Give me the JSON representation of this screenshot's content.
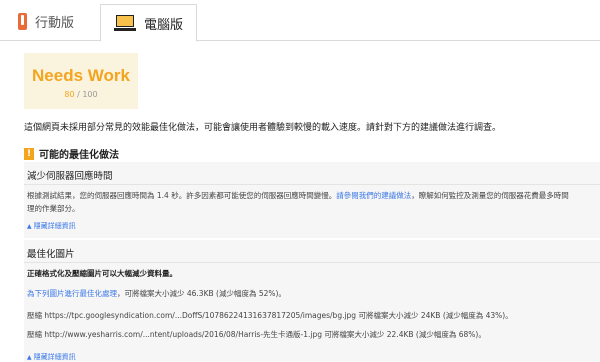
{
  "tabs": {
    "mobile": "行動版",
    "desktop": "電腦版"
  },
  "score": {
    "label": "Needs Work",
    "value": "80",
    "suffix": " / 100"
  },
  "intro": "這個網頁未採用部分常見的效能最佳化做法，可能會讓使用者體驗到較慢的載入速度。請針對下方的建議做法進行調查。",
  "possible": {
    "icon": "!",
    "title": "可能的最佳化做法"
  },
  "rule1": {
    "title": "減少伺服器回應時間",
    "text_prefix": "根據測試結果，您的伺服器回應時間為 1.4 秒。許多因素都可能使您的伺服器回應時間變慢。",
    "link": "請參閱我們的建議做法",
    "text_suffix": "，瞭解如何監控及測量您的伺服器花費最多時間",
    "text_line2": "理的作業部分。",
    "toggle": "隱藏詳細資訊"
  },
  "rule2": {
    "title": "最佳化圖片",
    "subtitle": "正確格式化及壓縮圖片可以大幅減少資料量。",
    "link_line_link": "為下列圖片進行最佳化處理",
    "link_line_text": "，可將檔案大小減少 46.3KB (減少幅度為 52%)。",
    "item1": "壓縮 https://tpc.googlesyndication.com/...DoffS/10786224131637817205/images/bg.jpg 可將檔案大小減少 24KB (減少幅度為 43%)。",
    "item2": "壓縮 http://www.yesharris.com/...ntent/uploads/2016/08/Harris-先生卡通版-1.jpg 可將檔案大小減少 22.4KB (減少幅度為 68%)。",
    "toggle": "隱藏詳細資訊"
  },
  "colors": {
    "accent": "#f3a51e",
    "link": "#3b78e7",
    "mobile_icon": "#ea6a38"
  },
  "icons": {
    "mobile": "mobile-phone-icon",
    "desktop": "laptop-icon",
    "warning": "warning-icon",
    "toggle": "triangle-up-icon"
  }
}
